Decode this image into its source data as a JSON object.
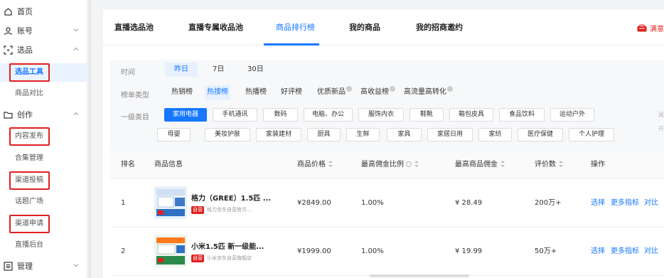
{
  "sidebar": {
    "groups": [
      {
        "label": "首页",
        "icon": "home-icon"
      },
      {
        "label": "账号",
        "icon": "user-icon"
      },
      {
        "label": "选品",
        "icon": "scan-icon"
      },
      {
        "label": "创作",
        "icon": "folder-icon"
      },
      {
        "label": "管理",
        "icon": "list-icon"
      }
    ],
    "items": [
      {
        "label": "选品工具"
      },
      {
        "label": "商品对比"
      },
      {
        "label": "内容发布"
      },
      {
        "label": "合集管理"
      },
      {
        "label": "渠道投稿"
      },
      {
        "label": "话题广场"
      },
      {
        "label": "渠道申请"
      },
      {
        "label": "直播后台"
      }
    ]
  },
  "topnav": {
    "tabs": [
      {
        "label": "直播选品池"
      },
      {
        "label": "直播专属收品池"
      },
      {
        "label": "商品排行榜"
      },
      {
        "label": "我的商品"
      },
      {
        "label": "我的招商邀约"
      }
    ],
    "notice_label": "满意"
  },
  "filters": {
    "time": {
      "label": "时间",
      "options": [
        "昨日",
        "7日",
        "30日"
      ]
    },
    "list_type": {
      "label": "榜单类型",
      "options": [
        "热销榜",
        "热搜榜",
        "热播榜",
        "好评榜",
        "优质新品",
        "高收益榜",
        "高流量高转化"
      ]
    },
    "category": {
      "label": "一级类目",
      "row1": [
        "家用电器",
        "手机通讯",
        "数码",
        "电脑、办公",
        "服饰内衣",
        "鞋靴",
        "箱包皮具",
        "食品饮料",
        "运动户外"
      ],
      "row2": [
        "母婴",
        "美妆护肤",
        "家装建材",
        "厨具",
        "生鲜",
        "家具",
        "家居日用",
        "家纺",
        "医疗保健",
        "个人护理"
      ],
      "more": "展开"
    }
  },
  "table": {
    "headers": {
      "rank": "排名",
      "info": "商品信息",
      "price": "商品价格",
      "ratio": "最高佣金比例",
      "commission": "最高商品佣金",
      "reviews": "评价数",
      "ops": "操作"
    },
    "rows": [
      {
        "rank": "1",
        "name": "格力（GREE）1.5匹 ...",
        "badge": "自营",
        "shop": "格力京东自营官方...",
        "price": "¥2849.00",
        "ratio": "1.00%",
        "commission": "¥ 28.49",
        "reviews": "200万+",
        "op1": "选择",
        "op2": "更多指标",
        "op3": "对比"
      },
      {
        "rank": "2",
        "name": "小米1.5匹 新一级能...",
        "badge": "自营",
        "shop": "小米京东自营旗舰店",
        "price": "¥1999.00",
        "ratio": "1.00%",
        "commission": "¥ 19.99",
        "reviews": "50万+",
        "op1": "选择",
        "op2": "更多指标",
        "op3": "对比"
      }
    ]
  },
  "colors": {
    "accent": "#1677ff",
    "highlight": "#e02020"
  }
}
